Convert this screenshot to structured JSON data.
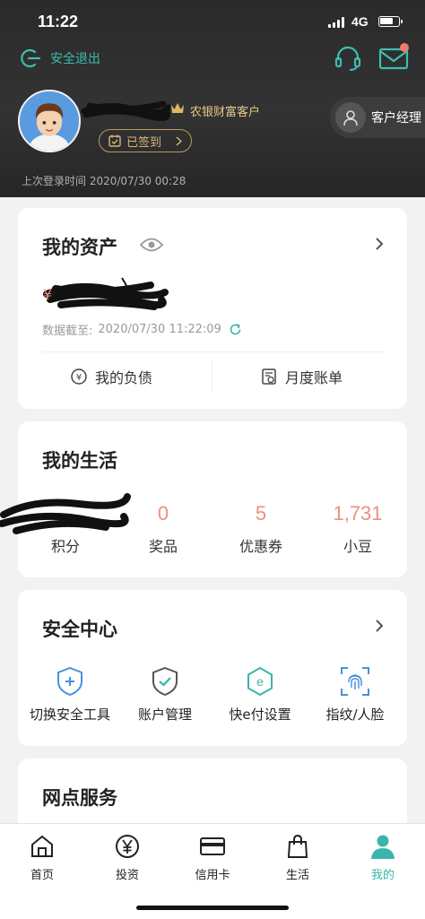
{
  "status_bar": {
    "time": "11:22",
    "network": "4G"
  },
  "header": {
    "logout_label": "安全退出",
    "vip_label": "农银财富客户",
    "signin_label": "已签到",
    "manager_label": "客户经理",
    "last_login_text": "上次登录时间 2020/07/30 00:28"
  },
  "assets": {
    "title": "我的资产",
    "updated_label": "数据截至:",
    "updated_value": "2020/07/30 11:22:09",
    "actions": [
      {
        "label": "我的负债",
        "icon": "liability-icon"
      },
      {
        "label": "月度账单",
        "icon": "bill-icon"
      }
    ]
  },
  "life": {
    "title": "我的生活",
    "stats": [
      {
        "value": "",
        "label": "积分"
      },
      {
        "value": "0",
        "label": "奖品"
      },
      {
        "value": "5",
        "label": "优惠券"
      },
      {
        "value": "1,731",
        "label": "小豆"
      }
    ]
  },
  "security": {
    "title": "安全中心",
    "items": [
      {
        "label": "切换安全工具",
        "icon": "shield-plus-icon"
      },
      {
        "label": "账户管理",
        "icon": "shield-check-icon"
      },
      {
        "label": "快e付设置",
        "icon": "epay-icon"
      },
      {
        "label": "指纹/人脸",
        "icon": "fingerprint-icon"
      }
    ]
  },
  "outlets": {
    "title": "网点服务"
  },
  "tabbar": {
    "tabs": [
      {
        "label": "首页",
        "icon": "home-icon"
      },
      {
        "label": "投资",
        "icon": "yen-icon"
      },
      {
        "label": "信用卡",
        "icon": "credit-card-icon"
      },
      {
        "label": "生活",
        "icon": "bag-icon"
      },
      {
        "label": "我的",
        "icon": "person-icon",
        "active": true
      }
    ]
  },
  "colors": {
    "accent_teal": "#3bb5ab",
    "value_salmon": "#ef8f7c",
    "gold": "#d9b877",
    "header_bg": "#2c2c2c"
  }
}
